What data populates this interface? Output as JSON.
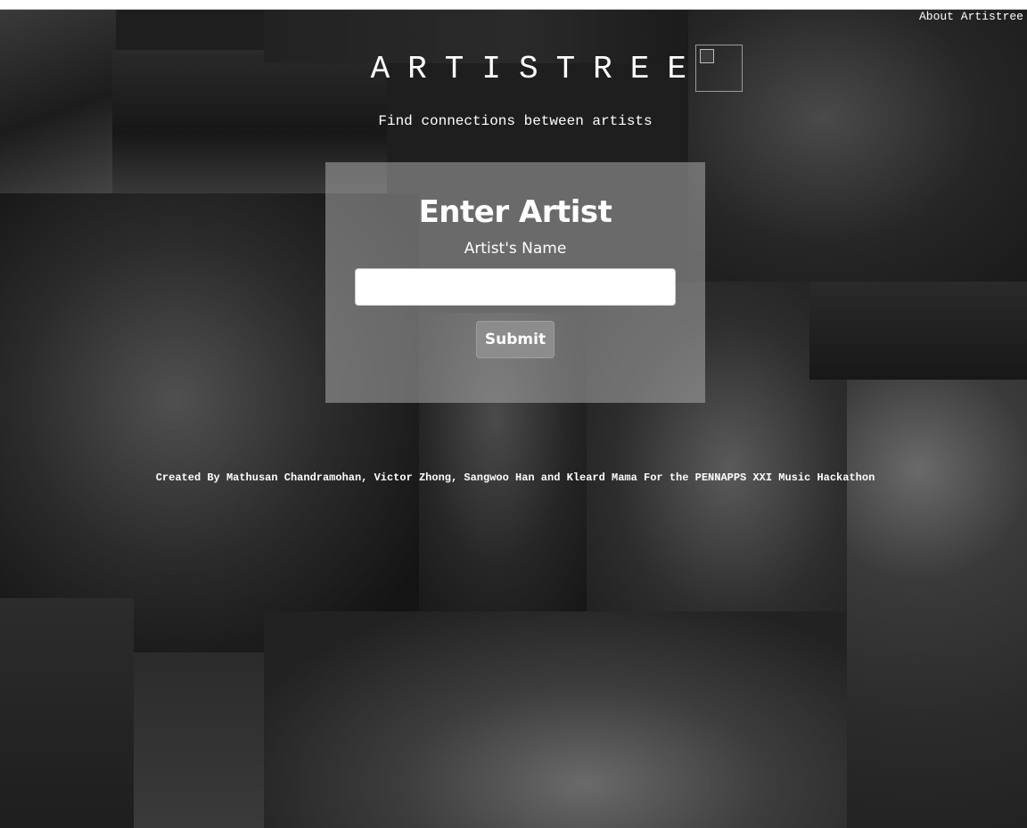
{
  "nav": {
    "about_label": "About Artistree"
  },
  "header": {
    "title": "ARTISTREE",
    "tagline": "Find connections between artists",
    "logo_icon": "broken-image-icon"
  },
  "form": {
    "heading": "Enter Artist",
    "field_label": "Artist's Name",
    "input_value": "",
    "input_placeholder": "",
    "submit_label": "Submit"
  },
  "footer": {
    "credits": "Created By Mathusan Chandramohan, Victor Zhong, Sangwoo Han and Kleard Mama For the PENNAPPS XXI Music Hackathon"
  },
  "colors": {
    "background": "#1e1e1e",
    "text": "#ffffff",
    "panel": "rgba(170,170,170,0.55)",
    "button": "#8c8c8c"
  }
}
